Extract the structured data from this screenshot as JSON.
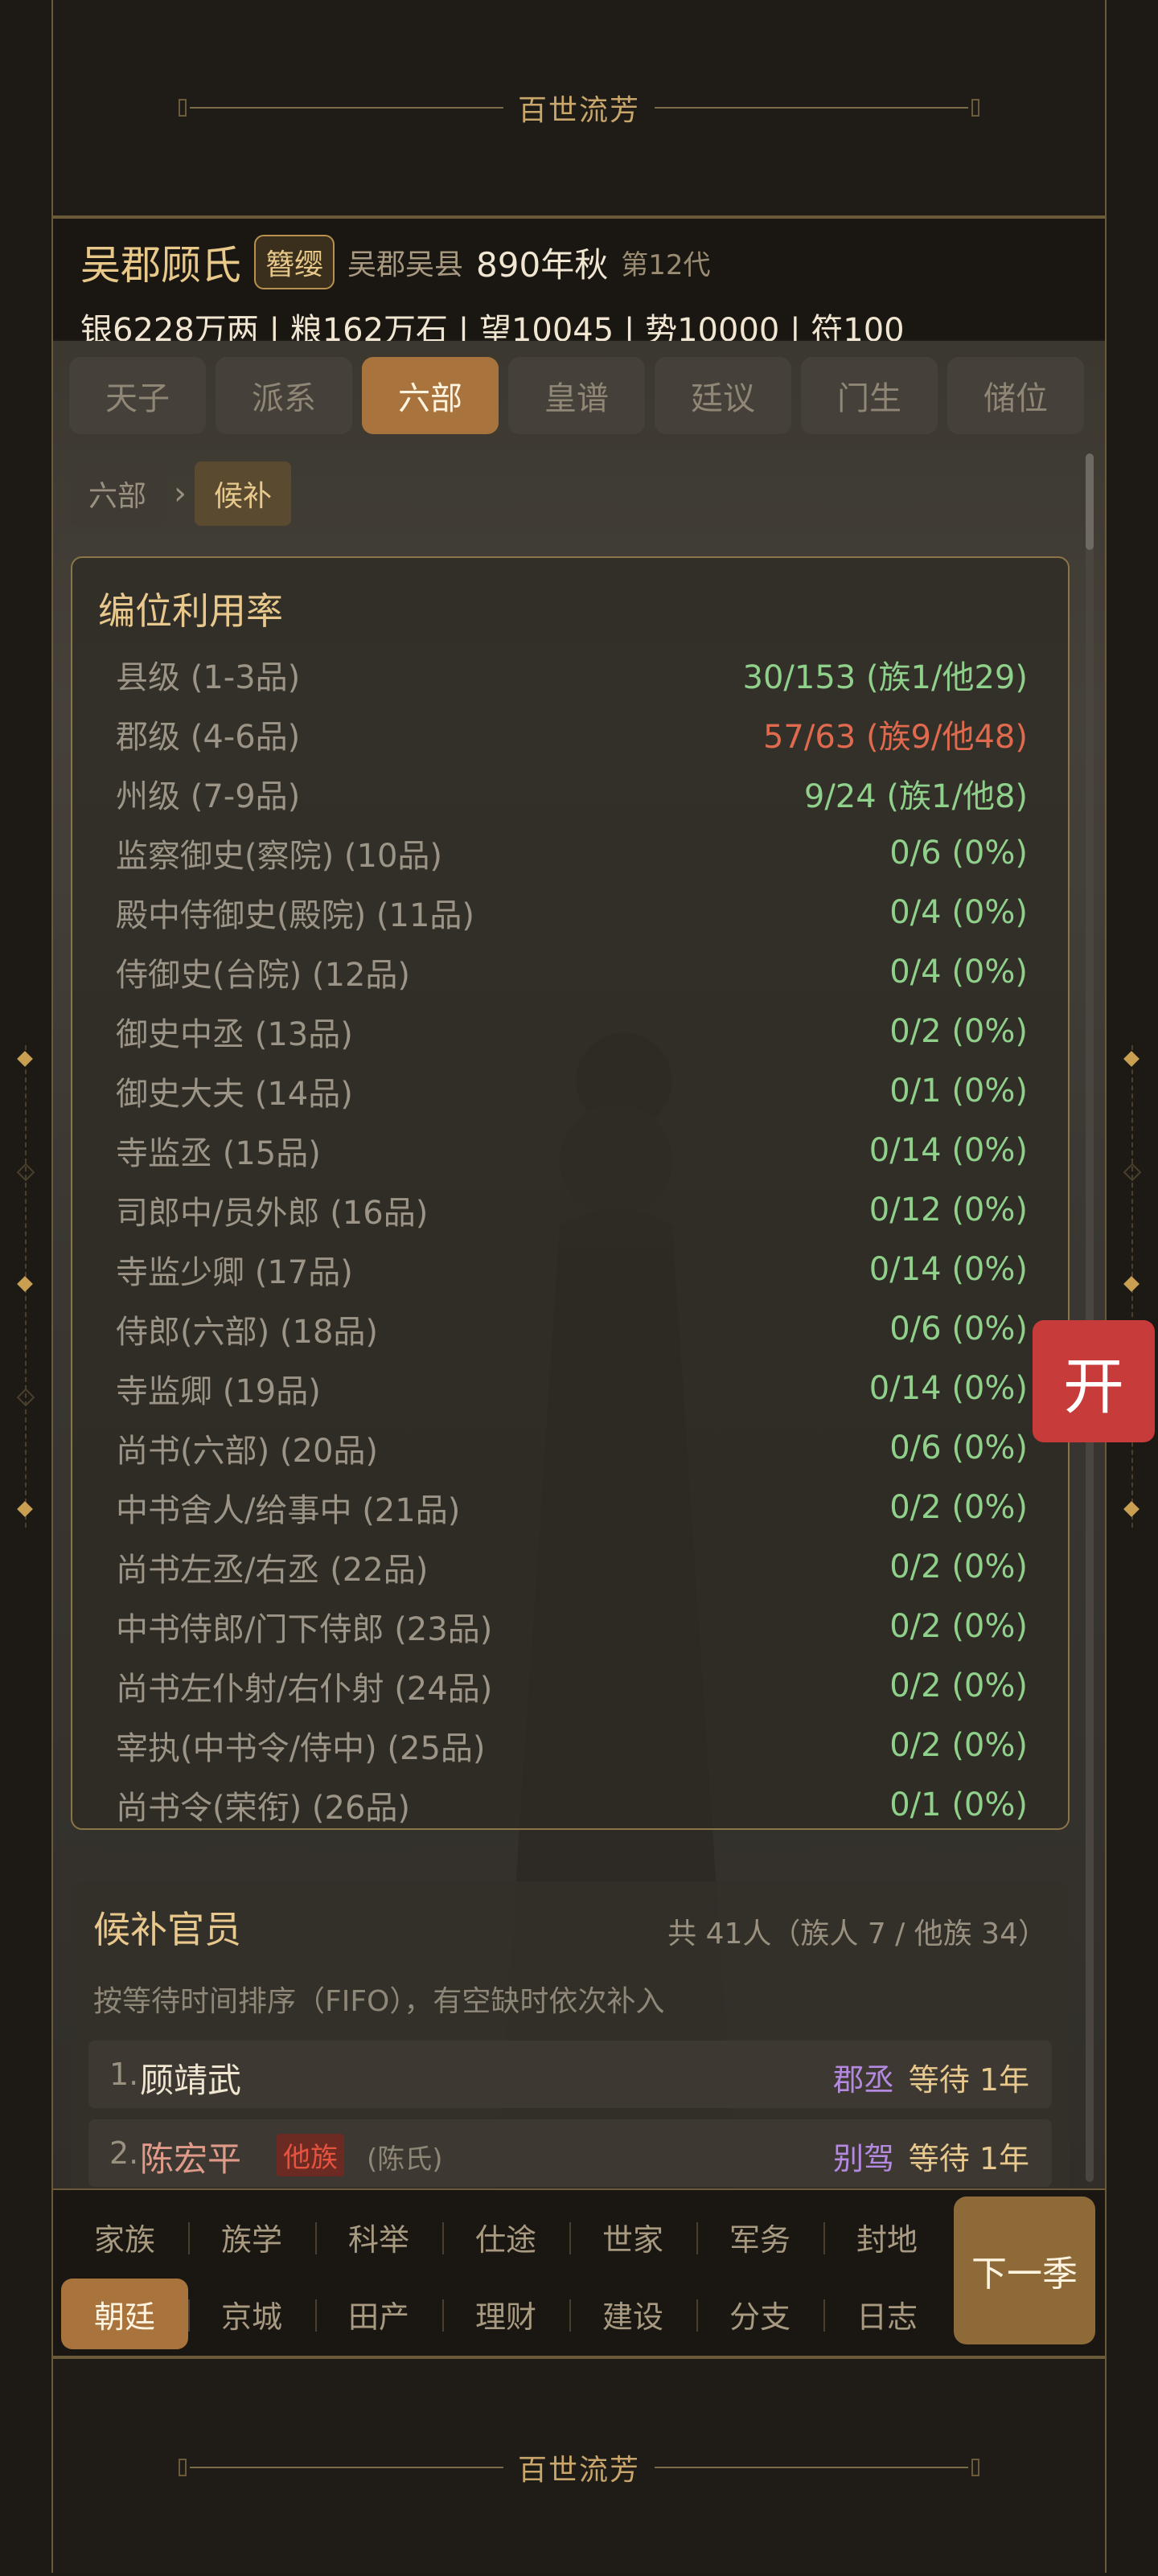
{
  "banner": {
    "title": "百世流芳"
  },
  "header": {
    "clan": "吴郡顾氏",
    "rank_badge": "簪缨",
    "place": "吴郡吴县",
    "date": "890年秋",
    "generation": "第12代",
    "stats": "银6228万两 | 粮162万石 | 望10045 | 势10000 | 符100"
  },
  "tabs": [
    "天子",
    "派系",
    "六部",
    "皇谱",
    "廷议",
    "门生",
    "储位"
  ],
  "active_tab": "六部",
  "breadcrumb": {
    "parent": "六部",
    "separator": "›",
    "current": "候补"
  },
  "utilization": {
    "title": "编位利用率",
    "rows": [
      {
        "label": "县级 (1-3品)",
        "value": "30/153 (族1/他29)"
      },
      {
        "label": "郡级 (4-6品)",
        "value": "57/63 (族9/他48)"
      },
      {
        "label": "州级 (7-9品)",
        "value": "9/24 (族1/他8)"
      },
      {
        "label": "监察御史(察院) (10品)",
        "value": "0/6 (0%)"
      },
      {
        "label": "殿中侍御史(殿院) (11品)",
        "value": "0/4 (0%)"
      },
      {
        "label": "侍御史(台院) (12品)",
        "value": "0/4 (0%)"
      },
      {
        "label": "御史中丞 (13品)",
        "value": "0/2 (0%)"
      },
      {
        "label": "御史大夫 (14品)",
        "value": "0/1 (0%)"
      },
      {
        "label": "寺监丞 (15品)",
        "value": "0/14 (0%)"
      },
      {
        "label": "司郎中/员外郎 (16品)",
        "value": "0/12 (0%)"
      },
      {
        "label": "寺监少卿 (17品)",
        "value": "0/14 (0%)"
      },
      {
        "label": "侍郎(六部) (18品)",
        "value": "0/6 (0%)"
      },
      {
        "label": "寺监卿 (19品)",
        "value": "0/14 (0%)"
      },
      {
        "label": "尚书(六部) (20品)",
        "value": "0/6 (0%)"
      },
      {
        "label": "中书舍人/给事中 (21品)",
        "value": "0/2 (0%)"
      },
      {
        "label": "尚书左丞/右丞 (22品)",
        "value": "0/2 (0%)"
      },
      {
        "label": "中书侍郎/门下侍郎 (23品)",
        "value": "0/2 (0%)"
      },
      {
        "label": "尚书左仆射/右仆射 (24品)",
        "value": "0/2 (0%)"
      },
      {
        "label": "宰执(中书令/侍中) (25品)",
        "value": "0/2 (0%)"
      },
      {
        "label": "尚书令(荣衔) (26品)",
        "value": "0/1 (0%)"
      }
    ],
    "warning_color": "#e06a4e",
    "ok_color": "#8fd08a"
  },
  "candidates": {
    "title": "候补官员",
    "count": "共 41人（族人 7 / 他族 34）",
    "description": "按等待时间排序（FIFO），有空缺时依次补入",
    "list": [
      {
        "num": "1.",
        "name": "顾靖武",
        "office": "郡丞",
        "wait": "等待 1年"
      },
      {
        "num": "2.",
        "name": "陈宏平",
        "tag": "他族",
        "clan": "(陈氏)",
        "office": "别驾",
        "wait": "等待 1年"
      }
    ]
  },
  "float_button": "开",
  "nav": {
    "row1": [
      "家族",
      "族学",
      "科举",
      "仕途",
      "世家",
      "军务",
      "封地"
    ],
    "row2": [
      "朝廷",
      "京城",
      "田产",
      "理财",
      "建设",
      "分支",
      "日志"
    ],
    "active": "朝廷",
    "next": "下一季"
  }
}
